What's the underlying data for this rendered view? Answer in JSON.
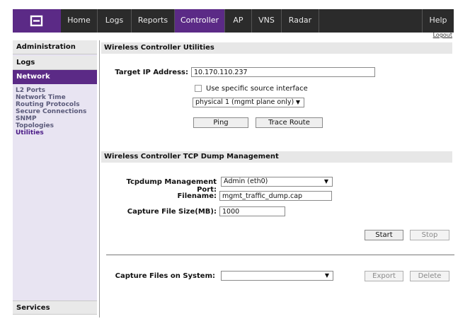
{
  "nav": {
    "tabs": [
      "Home",
      "Logs",
      "Reports",
      "Controller",
      "AP",
      "VNS",
      "Radar",
      "Help"
    ],
    "active": "Controller",
    "logout_label": "Logout"
  },
  "sidebar": {
    "administration": "Administration",
    "logs": "Logs",
    "network": "Network",
    "links": [
      "L2 Ports",
      "Network Time",
      "Routing Protocols",
      "Secure Connections",
      "SNMP",
      "Topologies",
      "Utilities"
    ],
    "current": "Utilities",
    "services": "Services"
  },
  "utilities": {
    "title": "Wireless Controller Utilities",
    "target_ip_label": "Target IP Address:",
    "target_ip_value": "10.170.110.237",
    "specific_source_label": "Use specific source interface",
    "specific_source_checked": false,
    "interface_value": "physical 1 (mgmt plane only)",
    "ping_label": "Ping",
    "trace_label": "Trace Route"
  },
  "tcpdump": {
    "title": "Wireless Controller TCP Dump Management",
    "port_label": "Tcpdump Management Port:",
    "port_value": "Admin (eth0)",
    "filename_label": "Filename:",
    "filename_value": "mgmt_traffic_dump.cap",
    "size_label": "Capture File Size(MB):",
    "size_value": "1000",
    "start_label": "Start",
    "stop_label": "Stop",
    "capture_files_label": "Capture Files on System:",
    "capture_files_value": "",
    "export_label": "Export",
    "delete_label": "Delete"
  },
  "colors": {
    "accent": "#5b2a86",
    "nav_bg": "#2b2b2b",
    "sidebar_bg": "#e8e4f2"
  }
}
